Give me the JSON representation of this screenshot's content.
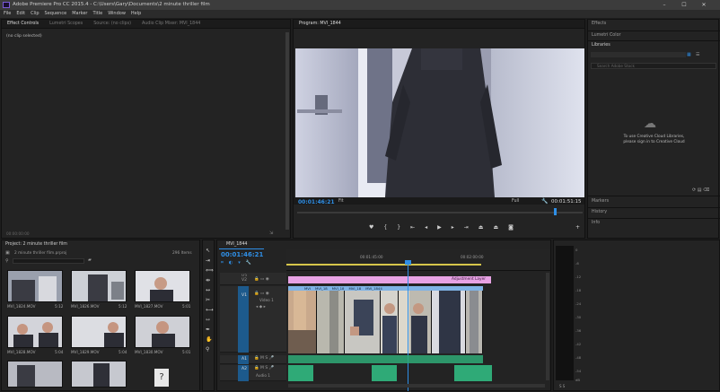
{
  "app": {
    "title": "Adobe Premiere Pro CC 2015.4 - C:\\Users\\Gary\\Documents\\2 minute thriller film",
    "window_controls": [
      "–",
      "☐",
      "✕"
    ]
  },
  "menu": [
    "File",
    "Edit",
    "Clip",
    "Sequence",
    "Marker",
    "Title",
    "Window",
    "Help"
  ],
  "source_panel": {
    "tabs": [
      "Effect Controls",
      "Lumetri Scopes",
      "Source: (no clips)",
      "Audio Clip Mixer: MVI_1844"
    ],
    "no_clip": "(no clip selected)",
    "timecode": "00:00:00:00"
  },
  "program": {
    "tab": "Program: MVI_1844",
    "timecode": "00:01:46:21",
    "fit": "Fit",
    "quality": "Full",
    "duration": "00:01:51:15"
  },
  "right_panel": {
    "items": [
      "Effects",
      "Lumetri Color",
      "Libraries"
    ],
    "search_placeholder": "Search Adobe Stock",
    "cc_message_1": "To use Creative Cloud Libraries,",
    "cc_message_2": "please sign in to Creative Cloud",
    "bottom_items": [
      "Markers",
      "History",
      "Info"
    ]
  },
  "project": {
    "title": "Project: 2 minute thriller film",
    "file": "2 minute thriller film.prproj",
    "count": "296 Items",
    "thumbs": [
      {
        "name": "MVI_1824.MOV",
        "dur": "5:12"
      },
      {
        "name": "MVI_1826.MOV",
        "dur": "5:12"
      },
      {
        "name": "MVI_1827.MOV",
        "dur": "5:01"
      },
      {
        "name": "MVI_1828.MOV",
        "dur": "5:04"
      },
      {
        "name": "MVI_1829.MOV",
        "dur": "5:04"
      },
      {
        "name": "MVI_1830.MOV",
        "dur": "5:01"
      }
    ]
  },
  "timeline": {
    "tab": "MVI_1844",
    "timecode": "00:01:46:21",
    "ruler_marks": [
      "00:01:45:00",
      "00:02:00:00"
    ],
    "tracks_video": [
      "V3",
      "V2",
      "V1"
    ],
    "video1_name": "Video 1",
    "tracks_audio": [
      "A1",
      "A2"
    ],
    "audio1_name": "Audio 1",
    "adjustment_layer": "Adjustment Layer",
    "clip_labels": [
      "MVI",
      "MVI_18",
      "MVI_18",
      "MVI_18",
      "MVI_1844"
    ]
  },
  "meter": {
    "ticks": [
      "0",
      "-6",
      "-12",
      "-18",
      "-24",
      "-30",
      "-36",
      "-42",
      "-48",
      "-54",
      "dB"
    ],
    "footer": "S S"
  },
  "colors": {
    "accent_blue": "#2f8fe6",
    "adjustment_pink": "#e7a2e4",
    "audio_green": "#2faa77",
    "track_blue": "#1d5a8c"
  }
}
